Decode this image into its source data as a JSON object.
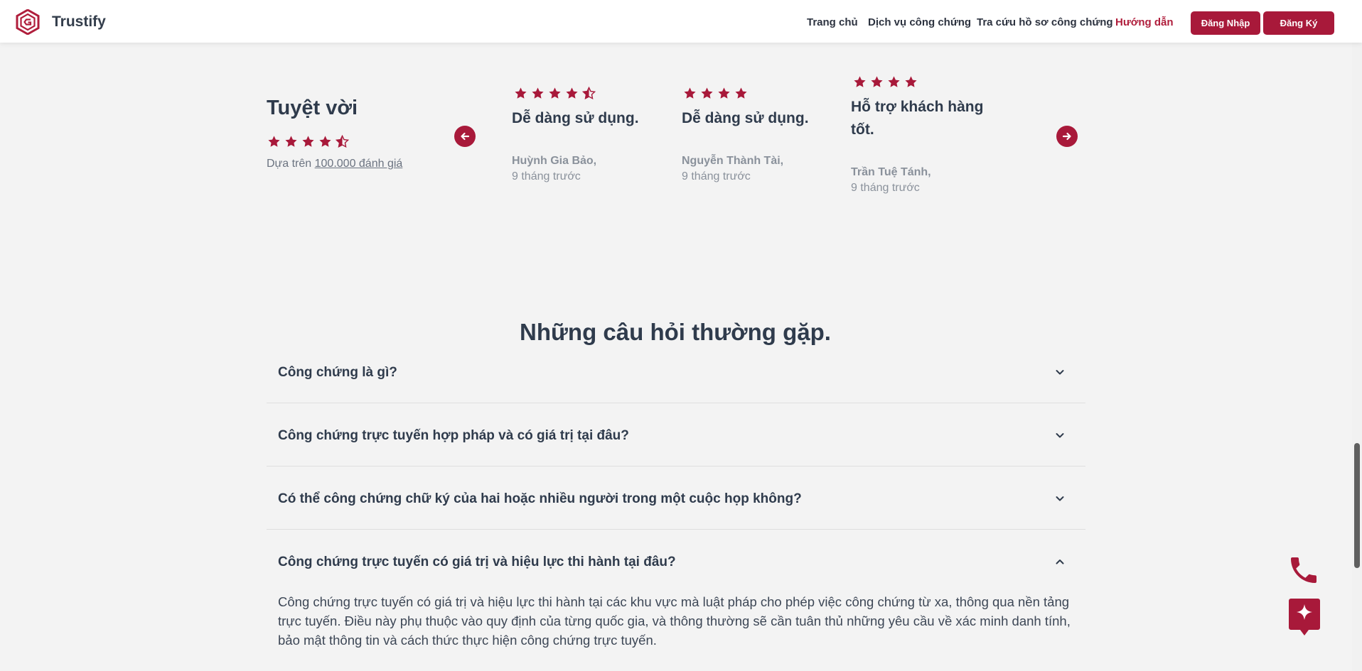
{
  "header": {
    "brand": "Trustify",
    "nav": [
      {
        "label": "Trang chủ"
      },
      {
        "label": "Dịch vụ công chứng"
      },
      {
        "label": "Tra cứu hồ sơ công chứng"
      },
      {
        "label": "Hướng dẫn",
        "active": true
      }
    ],
    "login_label": "Đăng Nhập",
    "register_label": "Đăng Ký"
  },
  "summary": {
    "title": "Tuyệt vời",
    "rating": 4.5,
    "based_on": "Dựa trên ",
    "count_link": "100.000 đánh giá"
  },
  "reviews": [
    {
      "rating": 4.5,
      "title": "Dễ dàng sử dụng.",
      "author": "Huỳnh Gia Bảo,",
      "time": "9 tháng trước"
    },
    {
      "rating": 4,
      "title": "Dễ dàng sử dụng.",
      "author": "Nguyễn Thành Tài,",
      "time": "9 tháng trước"
    },
    {
      "rating": 4,
      "title": "Hỗ trợ khách hàng tốt.",
      "author": "Trần Tuệ Tánh,",
      "time": "9 tháng trước"
    }
  ],
  "faq": {
    "heading": "Những câu hỏi thường gặp.",
    "items": [
      {
        "question": "Công chứng là gì?",
        "expanded": false
      },
      {
        "question": "Công chứng trực tuyến hợp pháp và có giá trị tại đâu?",
        "expanded": false
      },
      {
        "question": "Có thể công chứng chữ ký của hai hoặc nhiều người trong một cuộc họp không?",
        "expanded": false
      },
      {
        "question": "Công chứng trực tuyến có giá trị và hiệu lực thi hành tại đâu?",
        "expanded": true,
        "answer": "Công chứng trực tuyến có giá trị và hiệu lực thi hành tại các khu vực mà luật pháp cho phép việc công chứng từ xa, thông qua nền tảng trực tuyến. Điều này phụ thuộc vào quy định của từng quốc gia, và thông thường sẽ cần tuân thủ những yêu cầu về xác minh danh tính, bảo mật thông tin và cách thức thực hiện công chứng trực tuyến."
      }
    ]
  },
  "colors": {
    "accent": "#a8193a",
    "text": "#2f3b4c",
    "muted": "#8a919b",
    "background": "#f3f3f3"
  },
  "icons": [
    "trustify-logo-icon",
    "star-icon",
    "star-half-icon",
    "arrow-left-icon",
    "arrow-right-icon",
    "chevron-down-icon",
    "chevron-up-icon",
    "phone-icon",
    "sparkle-chat-icon"
  ]
}
